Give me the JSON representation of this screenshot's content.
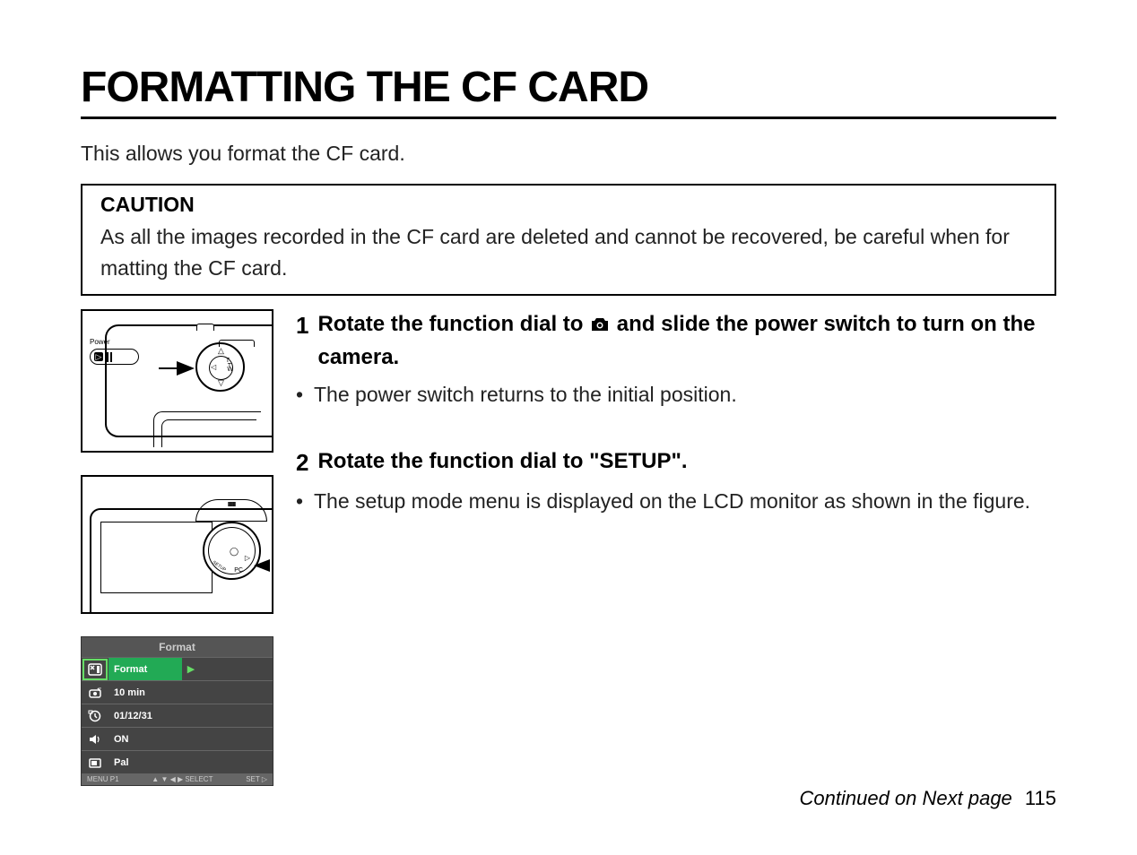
{
  "title": "FORMATTING THE CF CARD",
  "intro": "This allows you format the CF card.",
  "caution": {
    "label": "CAUTION",
    "text": "As all the images recorded in the CF card are deleted and cannot be recovered, be careful when for  matting the CF card."
  },
  "diagram1": {
    "power_label": "Power",
    "dpad_t": "T",
    "dpad_w": "W"
  },
  "diagram2": {
    "setup_label": "SETUP"
  },
  "menu": {
    "header": "Format",
    "rows": [
      {
        "label": "Format",
        "selected": true,
        "arrow": "▶"
      },
      {
        "label": "10 min"
      },
      {
        "label": "01/12/31"
      },
      {
        "label": "ON"
      },
      {
        "label": "Pal"
      }
    ],
    "footer_left": "MENU P1",
    "footer_mid": "▲ ▼ ◀ ▶ SELECT",
    "footer_right": "SET ▷"
  },
  "steps": {
    "step1": {
      "num": "1",
      "text_before": "Rotate the function dial to ",
      "text_after": " and slide the power switch to turn on the camera.",
      "bullet": "The power switch returns to the initial position."
    },
    "step2": {
      "num": "2",
      "text": "Rotate the function dial to \"SETUP\".",
      "bullet": "The setup mode menu is displayed on the LCD monitor as shown in the figure."
    }
  },
  "footer": {
    "text": "Continued on Next page",
    "page": "115"
  }
}
